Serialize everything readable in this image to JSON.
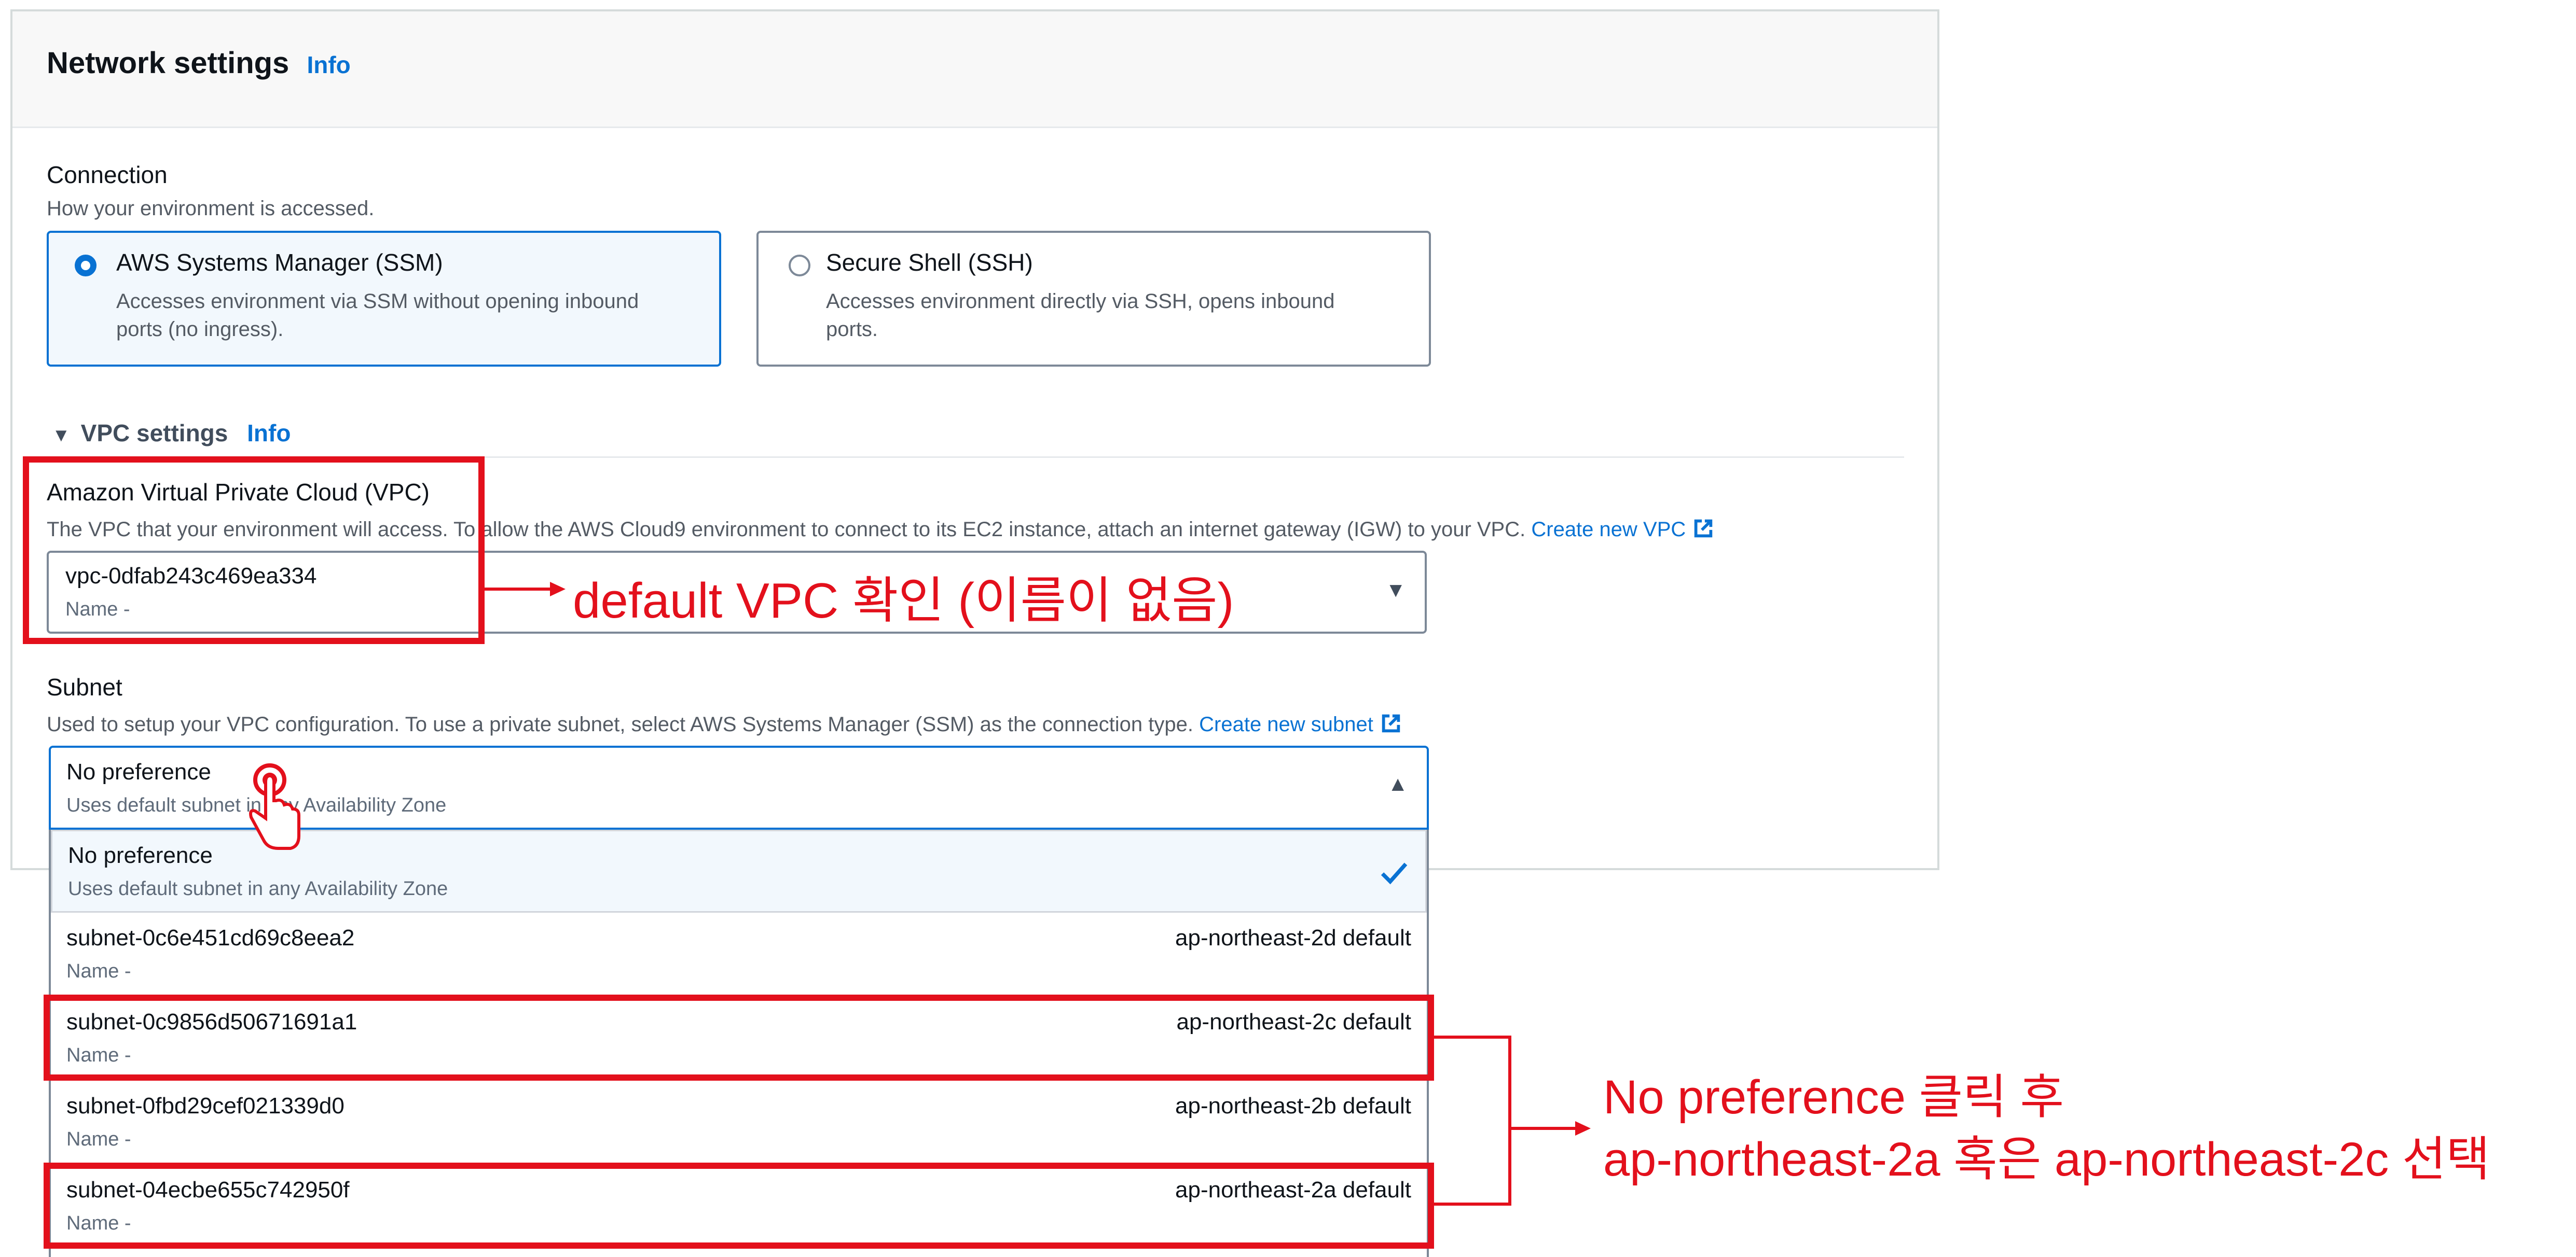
{
  "section": {
    "title": "Network settings",
    "info": "Info"
  },
  "connection": {
    "label": "Connection",
    "description": "How your environment is accessed.",
    "options": [
      {
        "title": "AWS Systems Manager (SSM)",
        "desc_line1": "Accesses environment via SSM without opening inbound",
        "desc_line2": "ports (no ingress).",
        "selected": true
      },
      {
        "title": "Secure Shell (SSH)",
        "desc_line1": "Accesses environment directly via SSH, opens inbound",
        "desc_line2": "ports.",
        "selected": false
      }
    ]
  },
  "vpc_settings": {
    "toggle": "VPC settings",
    "info": "Info"
  },
  "vpc": {
    "label": "Amazon Virtual Private Cloud (VPC)",
    "description": "The VPC that your environment will access. To allow the AWS Cloud9 environment to connect to its EC2 instance, attach an internet gateway (IGW) to your VPC.",
    "create_link": "Create new VPC",
    "value": "vpc-0dfab243c469ea334",
    "value_name": "Name -"
  },
  "subnet": {
    "label": "Subnet",
    "description": "Used to setup your VPC configuration. To use a private subnet, select AWS Systems Manager (SSM) as the connection type.",
    "create_link": "Create new subnet",
    "value": "No preference",
    "value_sub": "Uses default subnet in any Availability Zone",
    "options": [
      {
        "id": "No preference",
        "sub": "Uses default subnet in any Availability Zone",
        "zone": "",
        "selected": true
      },
      {
        "id": "subnet-0c6e451cd69c8eea2",
        "sub": "Name -",
        "zone": "ap-northeast-2d default"
      },
      {
        "id": "subnet-0c9856d50671691a1",
        "sub": "Name -",
        "zone": "ap-northeast-2c default"
      },
      {
        "id": "subnet-0fbd29cef021339d0",
        "sub": "Name -",
        "zone": "ap-northeast-2b default"
      },
      {
        "id": "subnet-04ecbe655c742950f",
        "sub": "Name -",
        "zone": "ap-northeast-2a default"
      }
    ]
  },
  "annotations": {
    "vpc_note": "default VPC 확인 (이름이 없음)",
    "subnet_note_line1": "No preference 클릭 후",
    "subnet_note_line2": "ap-northeast-2a 혹은 ap-northeast-2c 선택"
  },
  "colors": {
    "accent": "#0972d3",
    "annotation": "#e3101c",
    "selected_bg": "#f2f8fd"
  }
}
